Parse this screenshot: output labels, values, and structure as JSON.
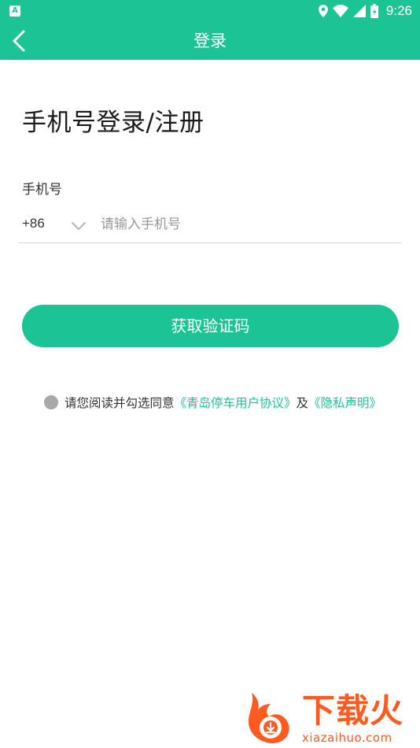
{
  "status_bar": {
    "app_indicator": "A",
    "time": "9:26"
  },
  "app_bar": {
    "title": "登录"
  },
  "page": {
    "heading": "手机号登录/注册",
    "phone_label": "手机号",
    "country_code": "+86",
    "phone_placeholder": "请输入手机号",
    "phone_value": "",
    "get_code_label": "获取验证码"
  },
  "agreement": {
    "prefix": "请您阅读并勾选同意",
    "terms_link": "《青岛停车用户协议》",
    "conjunction": "及",
    "privacy_link": "《隐私声明》"
  },
  "watermark": {
    "title": "下载火",
    "url": "xiazaihuo.com"
  },
  "colors": {
    "accent": "#1cc495",
    "radio_unchecked": "#a8a8a8",
    "watermark": "#ff5a1f"
  }
}
